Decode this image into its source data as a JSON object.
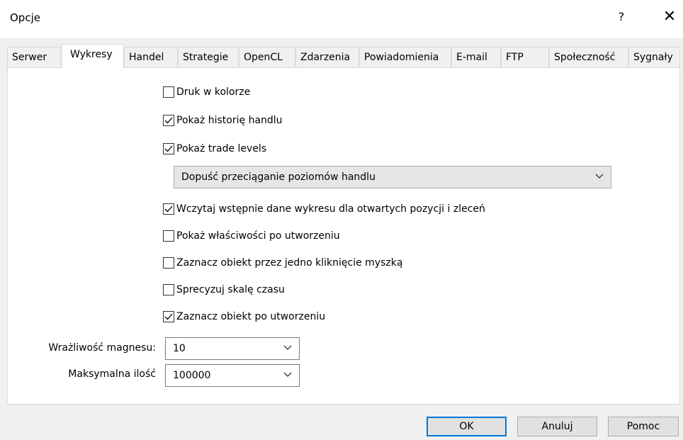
{
  "window": {
    "title": "Opcje",
    "help_glyph": "?",
    "close_glyph": "✕"
  },
  "tabs": [
    {
      "label": "Serwer"
    },
    {
      "label": "Wykresy"
    },
    {
      "label": "Handel"
    },
    {
      "label": "Strategie"
    },
    {
      "label": "OpenCL"
    },
    {
      "label": "Zdarzenia"
    },
    {
      "label": "Powiadomienia"
    },
    {
      "label": "E-mail"
    },
    {
      "label": "FTP"
    },
    {
      "label": "Społeczność"
    },
    {
      "label": "Sygnały"
    }
  ],
  "active_tab": "Wykresy",
  "options": [
    {
      "label": "Druk w kolorze",
      "checked": false
    },
    {
      "label": "Pokaż historię handlu",
      "checked": true
    },
    {
      "label": "Pokaż trade levels",
      "checked": true
    },
    {
      "label": "Wczytaj wstępnie dane wykresu dla otwartych pozycji i zleceń",
      "checked": true
    },
    {
      "label": "Pokaż właściwości po utworzeniu",
      "checked": false
    },
    {
      "label": "Zaznacz obiekt przez jedno kliknięcie myszką",
      "checked": false
    },
    {
      "label": "Sprecyzuj skalę czasu",
      "checked": false
    },
    {
      "label": "Zaznacz obiekt po utworzeniu",
      "checked": true
    }
  ],
  "trade_levels_select": {
    "value": "Dopuść przeciąganie poziomów handlu"
  },
  "magnet": {
    "label": "Wrażliwość magnesu:",
    "value": "10"
  },
  "max_bars": {
    "label": "Maksymalna ilość",
    "value": "100000"
  },
  "buttons": {
    "ok": "OK",
    "cancel": "Anuluj",
    "help": "Pomoc"
  }
}
